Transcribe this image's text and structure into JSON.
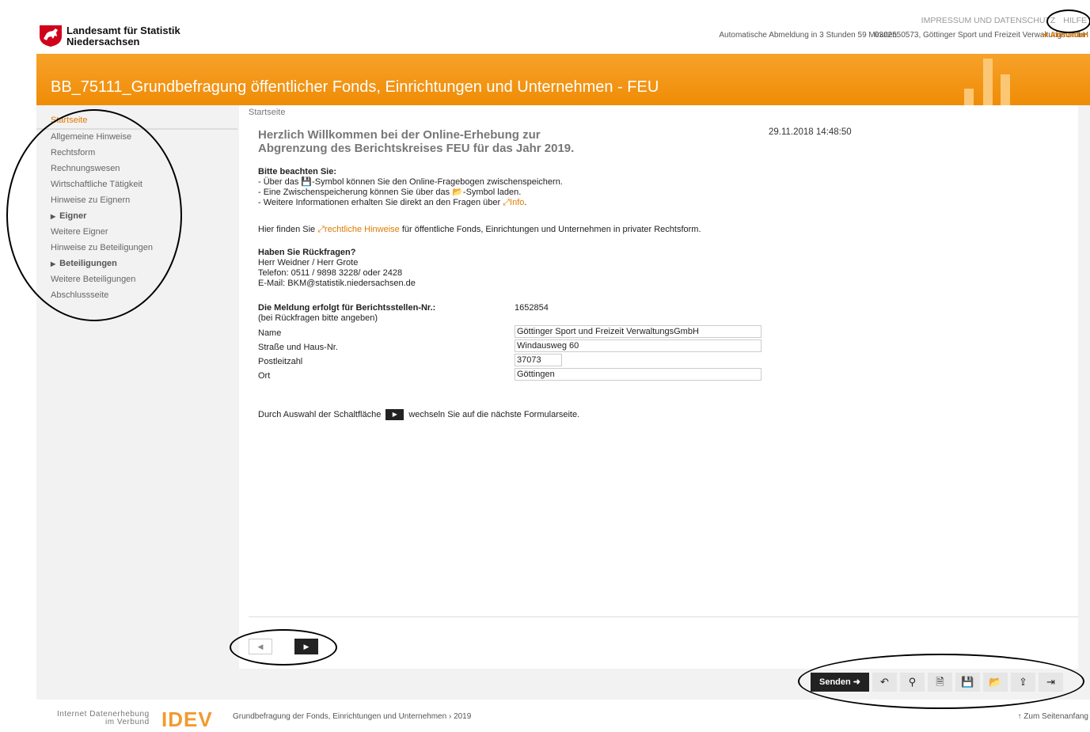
{
  "header": {
    "org_line1": "Landesamt für Statistik",
    "org_line2": "Niedersachsen",
    "impressum": "IMPRESSUM UND DATENSCHUTZ",
    "hilfe": "HILFE",
    "user": "0302550573, Göttinger Sport und Freizeit VerwaltungsGmbH",
    "auto_logout": "Automatische Abmeldung in 3 Stunden 59 Minuten",
    "logout": "➜ Abmelden"
  },
  "banner": {
    "title": "BB_75111_Grundbefragung öffentlicher Fonds, Einrichtungen und Unternehmen - FEU"
  },
  "sidebar": {
    "items": [
      "Startseite",
      "Allgemeine Hinweise",
      "Rechtsform",
      "Rechnungswesen",
      "Wirtschaftliche Tätigkeit",
      "Hinweise zu Eignern",
      "Eigner",
      "Weitere Eigner",
      "Hinweise zu Beteiligungen",
      "Beteiligungen",
      "Weitere Beteiligungen",
      "Abschlussseite"
    ]
  },
  "main": {
    "breadcrumb": "Startseite",
    "welcome_line1": "Herzlich Willkommen bei der Online-Erhebung zur",
    "welcome_line2": "Abgrenzung des Berichtskreises FEU für das Jahr 2019.",
    "timestamp": "29.11.2018 14:48:50",
    "note_title": "Bitte beachten Sie:",
    "note1_a": "- Über das ",
    "note1_b": "-Symbol können Sie den Online-Fragebogen zwischenspeichern.",
    "note2_a": "- Eine Zwischenspeicherung können Sie über das ",
    "note2_b": "-Symbol laden.",
    "note3_a": "- Weitere Informationen erhalten Sie direkt an den Fragen über ",
    "note3_link": "Info",
    "note3_b": ".",
    "legal_a": "Hier finden Sie ",
    "legal_link": "rechtliche Hinweise",
    "legal_b": " für öffentliche Fonds, Einrichtungen und Unternehmen in privater Rechtsform.",
    "contact_title": "Haben Sie Rückfragen?",
    "contact_names": "Herr Weidner / Herr Grote",
    "contact_phone": "Telefon: 0511 / 9898 3228/ oder 2428",
    "contact_email": "E-Mail: BKM@statistik.niedersachsen.de",
    "report_label": "Die Meldung erfolgt für Berichtsstellen-Nr.:",
    "report_sub": "(bei Rückfragen bitte angeben)",
    "report_no": "1652854",
    "fields": {
      "name_label": "Name",
      "name_value": "Göttinger Sport und Freizeit VerwaltungsGmbH",
      "street_label": "Straße und Haus-Nr.",
      "street_value": "Windausweg 60",
      "zip_label": "Postleitzahl",
      "zip_value": "37073",
      "city_label": "Ort",
      "city_value": "Göttingen"
    },
    "next_a": "Durch Auswahl der Schaltfläche",
    "next_b": "wechseln Sie auf die nächste Formularseite."
  },
  "toolbar": {
    "send": "Senden ➜"
  },
  "footer": {
    "idev_line1": "Internet Datenerhebung",
    "idev_line2": "im Verbund",
    "idev_logo": "IDEV",
    "path": "Grundbefragung der Fonds, Einrichtungen und Unternehmen › 2019",
    "top": "↑ Zum Seitenanfang"
  }
}
